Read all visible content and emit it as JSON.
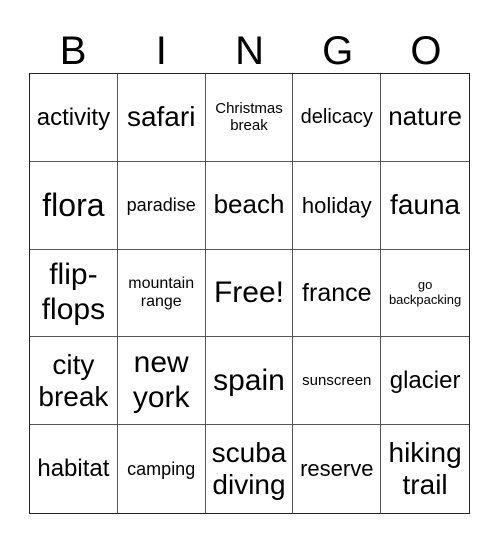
{
  "header": [
    "B",
    "I",
    "N",
    "G",
    "O"
  ],
  "cells": [
    {
      "text": "activity",
      "size": "s24"
    },
    {
      "text": "safari",
      "size": "s28"
    },
    {
      "text": "Christmas break",
      "size": "s15"
    },
    {
      "text": "delicacy",
      "size": "s20"
    },
    {
      "text": "nature",
      "size": "s26"
    },
    {
      "text": "flora",
      "size": "s32"
    },
    {
      "text": "paradise",
      "size": "s18"
    },
    {
      "text": "beach",
      "size": "s26"
    },
    {
      "text": "holiday",
      "size": "s22"
    },
    {
      "text": "fauna",
      "size": "s28"
    },
    {
      "text": "flip-flops",
      "size": "s30"
    },
    {
      "text": "mountain range",
      "size": "s16"
    },
    {
      "text": "Free!",
      "size": "s30"
    },
    {
      "text": "france",
      "size": "s25"
    },
    {
      "text": "go backpacking",
      "size": "s13"
    },
    {
      "text": "city break",
      "size": "s28"
    },
    {
      "text": "new york",
      "size": "s30"
    },
    {
      "text": "spain",
      "size": "s30"
    },
    {
      "text": "sunscreen",
      "size": "s15"
    },
    {
      "text": "glacier",
      "size": "s24"
    },
    {
      "text": "habitat",
      "size": "s24"
    },
    {
      "text": "camping",
      "size": "s18"
    },
    {
      "text": "scuba diving",
      "size": "s28"
    },
    {
      "text": "reserve",
      "size": "s22"
    },
    {
      "text": "hiking trail",
      "size": "s28"
    }
  ]
}
